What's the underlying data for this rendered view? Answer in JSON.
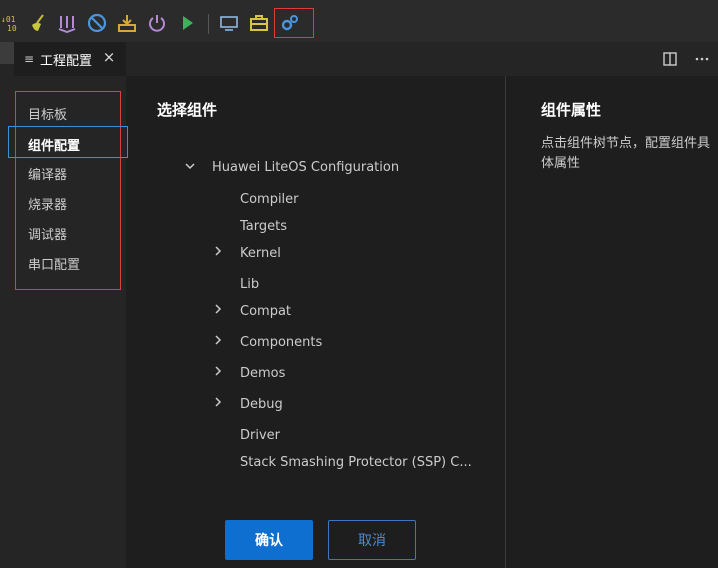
{
  "toolbar": {
    "icons": [
      "binary-icon",
      "clean-broom-icon",
      "build-icon",
      "stop-icon",
      "download-icon",
      "power-icon",
      "run-icon",
      "monitor-icon",
      "toolbox-icon",
      "settings-gears-icon"
    ]
  },
  "tab": {
    "label": "工程配置",
    "close": "×"
  },
  "nav": {
    "items": [
      {
        "label": "目标板"
      },
      {
        "label": "组件配置"
      },
      {
        "label": "编译器"
      },
      {
        "label": "烧录器"
      },
      {
        "label": "调试器"
      },
      {
        "label": "串口配置"
      }
    ],
    "selected": "组件配置"
  },
  "main": {
    "select_title": "选择组件",
    "tree": {
      "root": "Huawei LiteOS Configuration",
      "items": [
        {
          "label": "Compiler",
          "expandable": false
        },
        {
          "label": "Targets",
          "expandable": false
        },
        {
          "label": "Kernel",
          "expandable": true
        },
        {
          "label": "Lib",
          "expandable": false
        },
        {
          "label": "Compat",
          "expandable": true
        },
        {
          "label": "Components",
          "expandable": true
        },
        {
          "label": "Demos",
          "expandable": true
        },
        {
          "label": "Debug",
          "expandable": true
        },
        {
          "label": "Driver",
          "expandable": false
        },
        {
          "label": "Stack Smashing Protector (SSP) C...",
          "expandable": false
        }
      ]
    },
    "props_title": "组件属性",
    "props_hint": "点击组件树节点，配置组件具体属性",
    "confirm_label": "确认",
    "cancel_label": "取消"
  },
  "colors": {
    "accent": "#0e6fd0",
    "highlight_red": "#e03a3a",
    "selection_blue": "#3b8fd6"
  }
}
